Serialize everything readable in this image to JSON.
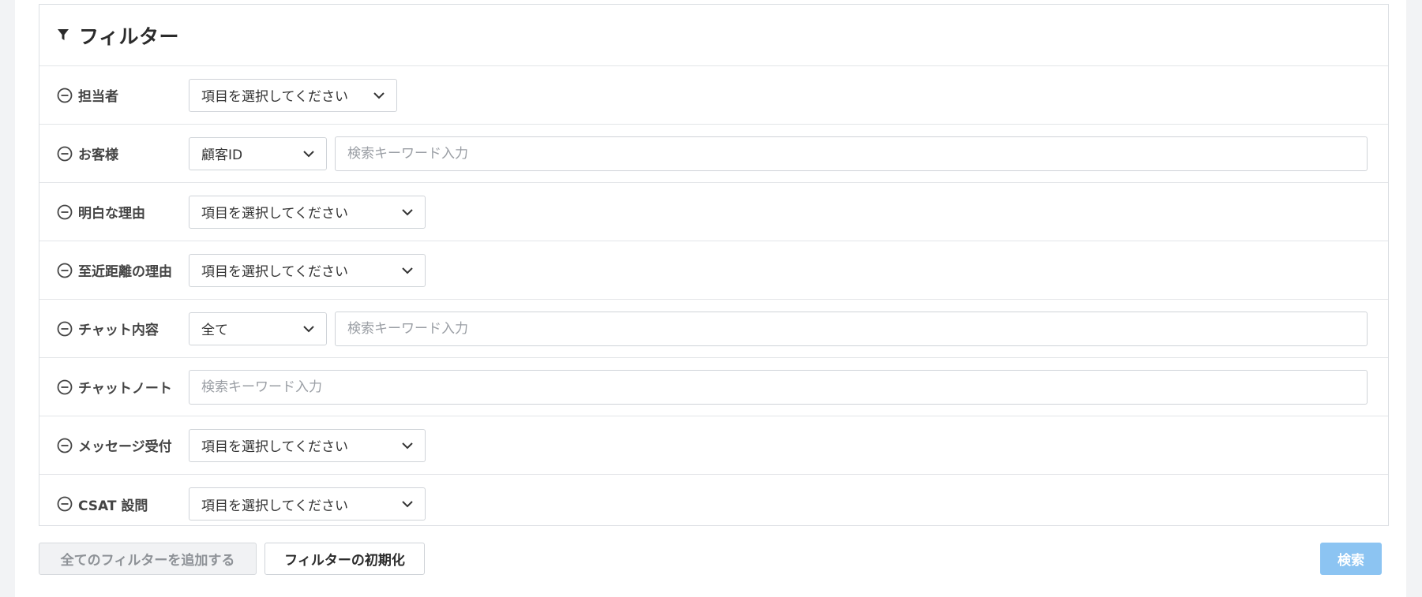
{
  "filter_panel": {
    "title": "フィルター",
    "rows": [
      {
        "label": "担当者",
        "select": "項目を選択してください"
      },
      {
        "label": "お客様",
        "select": "顧客ID",
        "placeholder": "検索キーワード入力"
      },
      {
        "label": "明白な理由",
        "select": "項目を選択してください"
      },
      {
        "label": "至近距離の理由",
        "select": "項目を選択してください"
      },
      {
        "label": "チャット内容",
        "select": "全て",
        "placeholder": "検索キーワード入力"
      },
      {
        "label": "チャットノート",
        "placeholder": "検索キーワード入力"
      },
      {
        "label": "メッセージ受付",
        "select": "項目を選択してください"
      },
      {
        "label": "CSAT 設問",
        "select": "項目を選択してください"
      }
    ]
  },
  "footer": {
    "add_all_label": "全てのフィルターを追加する",
    "reset_label": "フィルターの初期化",
    "search_label": "検索"
  },
  "colors": {
    "search_button": "#8cc4f2",
    "border": "#cfd3d8",
    "background": "#f2f3f5"
  },
  "icons": [
    "filter-icon",
    "minus-circle-icon",
    "chevron-down-icon"
  ]
}
